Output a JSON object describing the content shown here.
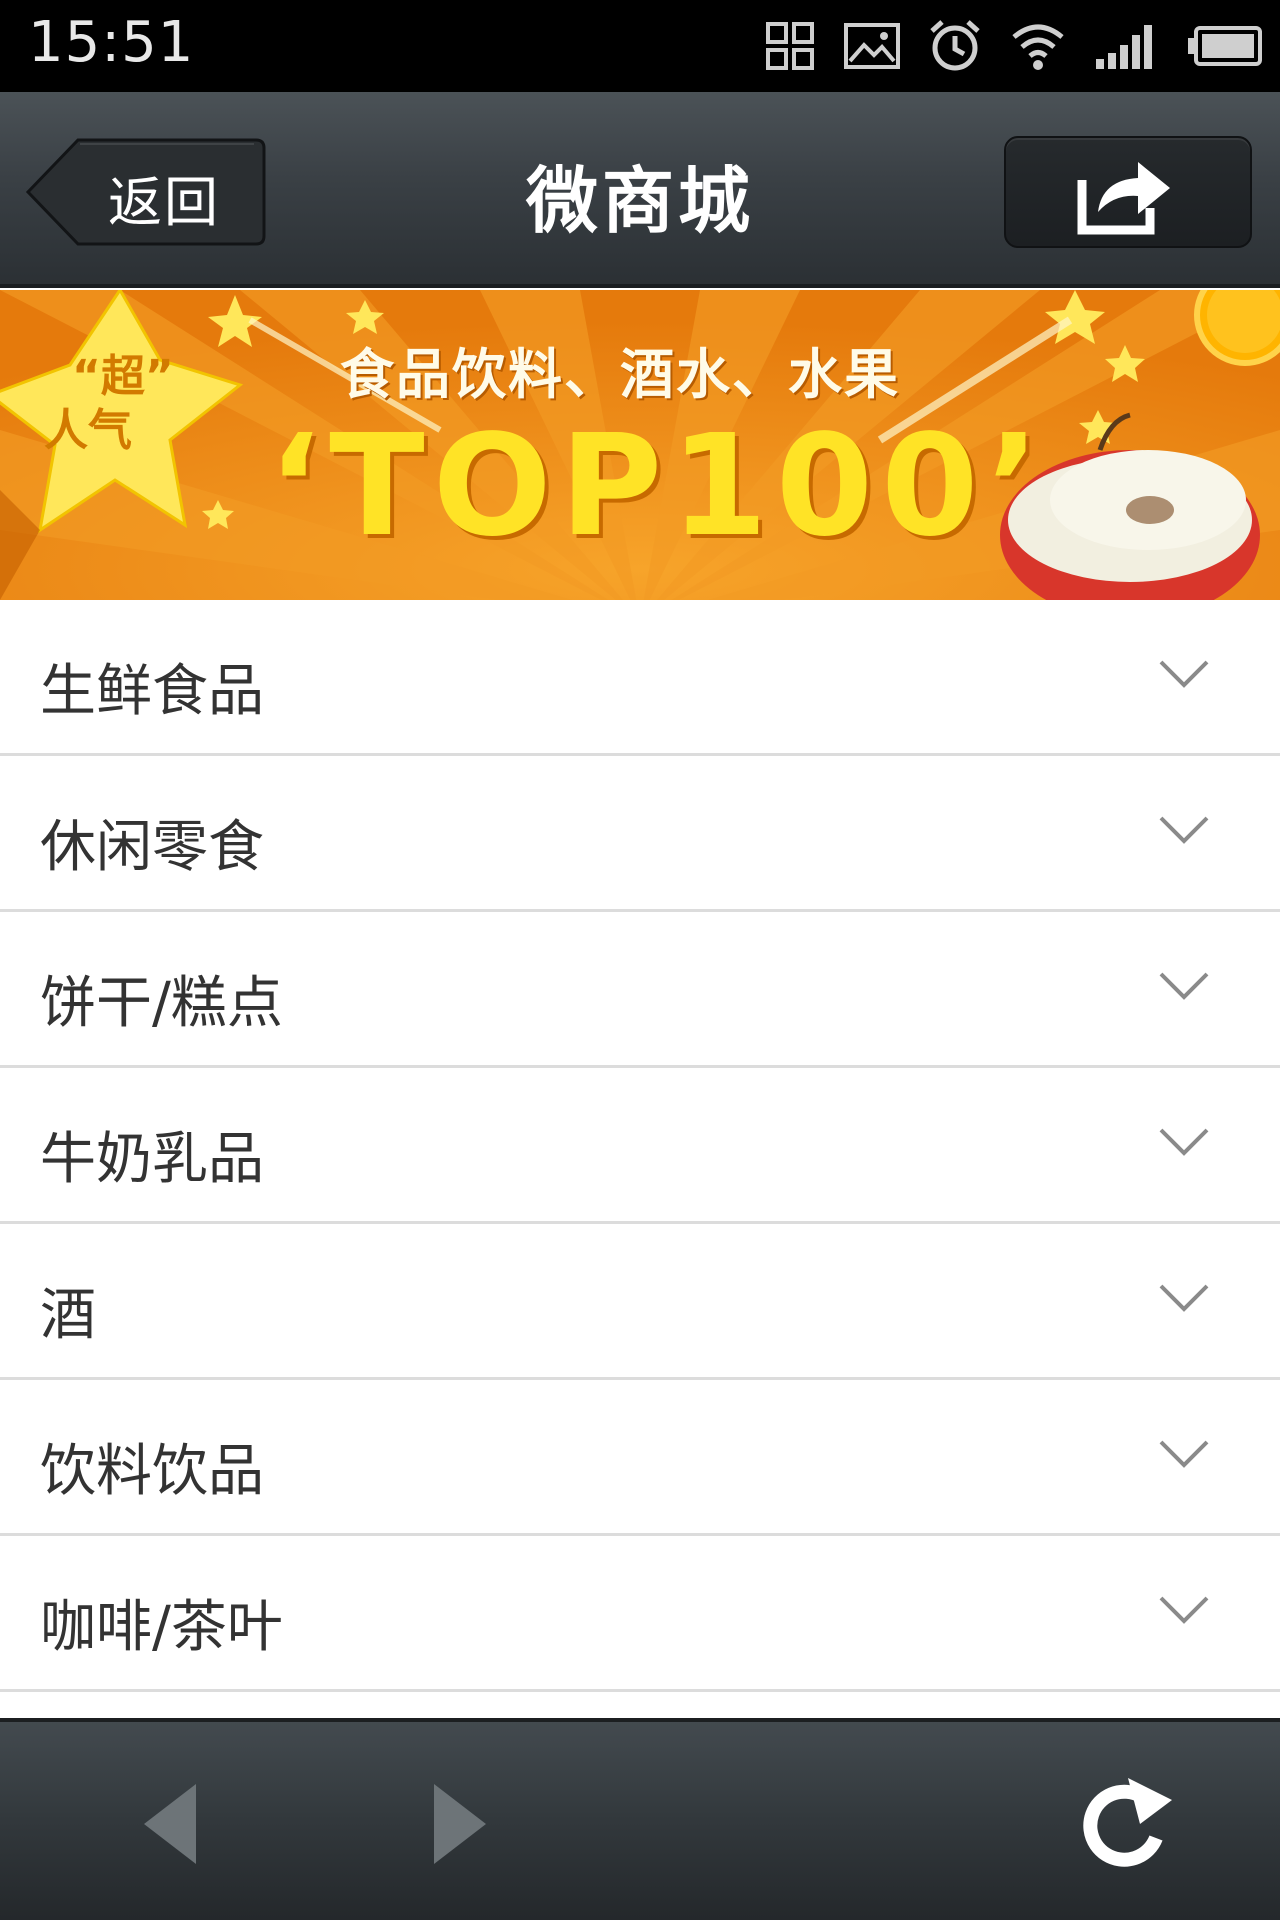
{
  "status_bar": {
    "time": "15:51",
    "icons": [
      "apps-grid-icon",
      "image-icon",
      "alarm-icon",
      "wifi-icon",
      "signal-icon",
      "battery-icon"
    ]
  },
  "nav": {
    "back_label": "返回",
    "title": "微商城",
    "share_icon": "share-icon"
  },
  "banner": {
    "badge_line1": "“超”",
    "badge_line2": "人气",
    "subtitle": "食品饮料、酒水、水果",
    "headline": "‘TOP100’"
  },
  "categories": [
    {
      "label": "生鲜食品"
    },
    {
      "label": "休闲零食"
    },
    {
      "label": "饼干/糕点"
    },
    {
      "label": "牛奶乳品"
    },
    {
      "label": "酒"
    },
    {
      "label": "饮料饮品"
    },
    {
      "label": "咖啡/茶叶"
    }
  ],
  "toolbar": {
    "icons": [
      "back-arrow-icon",
      "forward-arrow-icon",
      "refresh-icon"
    ]
  },
  "colors": {
    "banner_orange": "#ee8a17",
    "banner_yellow": "#ffe326",
    "nav_dark": "#2b3034"
  }
}
